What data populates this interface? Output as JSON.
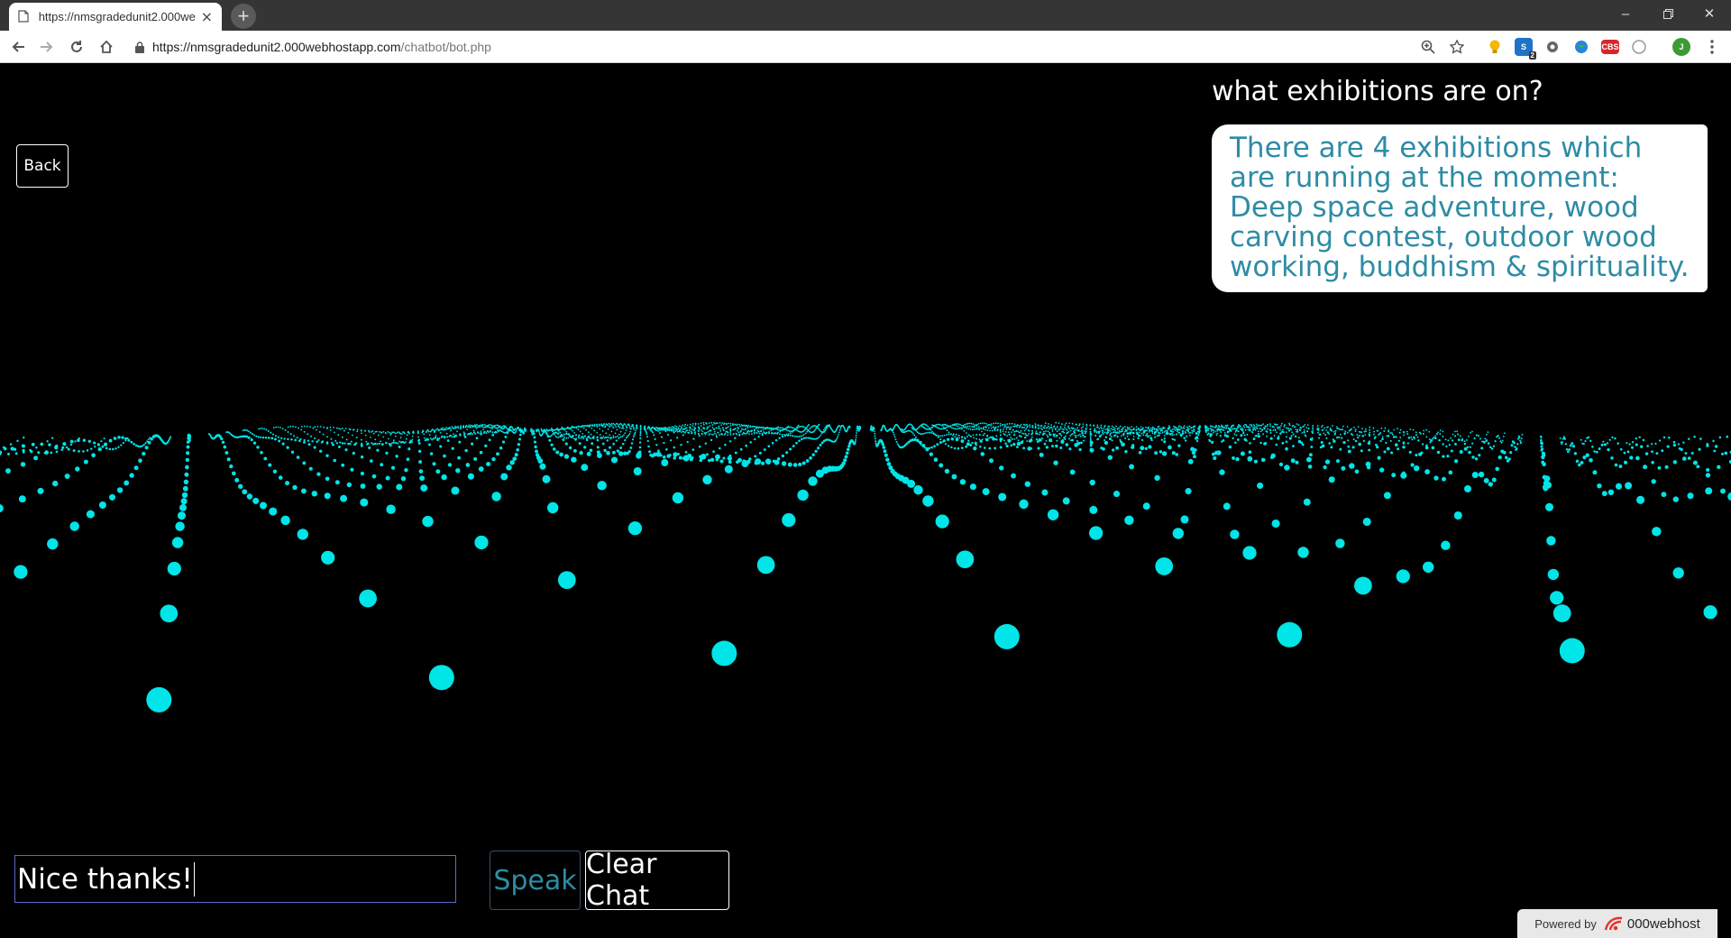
{
  "browser": {
    "tab_title": "https://nmsgradedunit2.000webhostapp.com/chatbot/bot.php",
    "url_host": "https://nmsgradedunit2.000webhostapp.com",
    "url_path": "/chatbot/bot.php",
    "extension_badge": "2",
    "extension_label": "CBS",
    "profile_initial": "J",
    "icons": [
      "page-icon",
      "close-icon",
      "new-tab-icon",
      "minimize-icon",
      "restore-icon",
      "window-close-icon",
      "back-arrow-icon",
      "forward-arrow-icon",
      "reload-icon",
      "home-icon",
      "lock-icon",
      "zoom-icon",
      "star-icon",
      "menu-icon"
    ]
  },
  "page": {
    "back_label": "Back",
    "user_message": "what exhibitions are on?",
    "bot_message": "There are 4 exhibitions which are running at the moment: Deep space adventure, wood carving contest, outdoor wood working, buddhism & spirituality.",
    "input_value": "Nice thanks!",
    "speak_label": "Speak",
    "clear_label": "Clear Chat",
    "powered_by": "Powered by",
    "host_name": "000webhost"
  },
  "colors": {
    "particle": "#00e5e8",
    "bot_text": "#2e8ca5",
    "background": "#000000"
  }
}
